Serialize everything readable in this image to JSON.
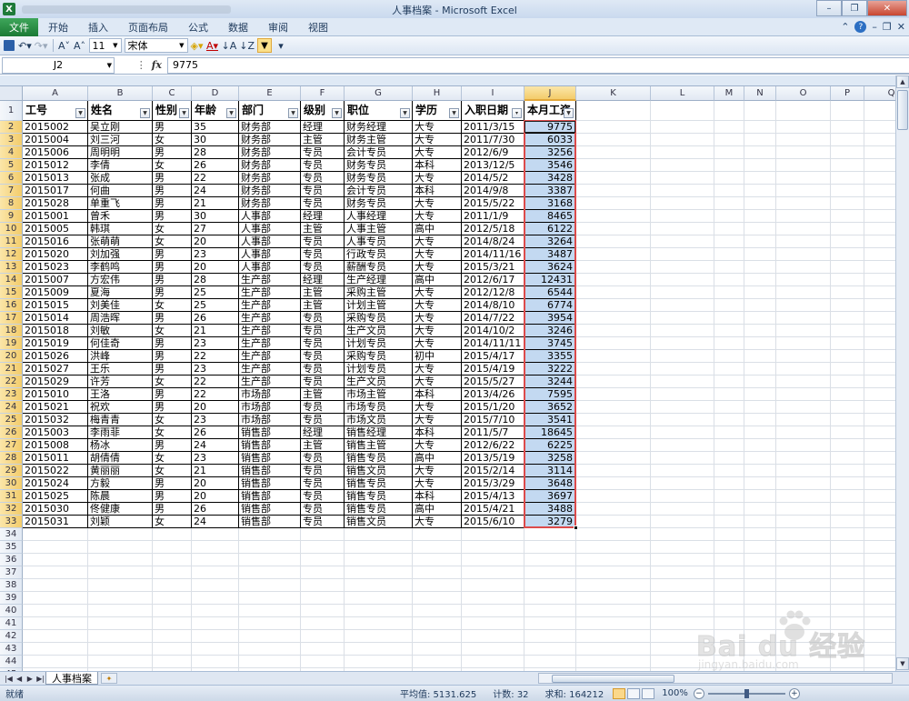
{
  "window": {
    "title": "人事档案  -  Microsoft Excel",
    "min": "–",
    "restore": "❐",
    "close": "✕"
  },
  "ribbon": {
    "tabs": [
      "文件",
      "开始",
      "插入",
      "页面布局",
      "公式",
      "数据",
      "审阅",
      "视图"
    ],
    "font_size": "11",
    "font_name": "宋体"
  },
  "formula_bar": {
    "name_box": "J2",
    "fx": "fx",
    "content": "9775"
  },
  "columns": [
    {
      "letter": "A",
      "w": 72
    },
    {
      "letter": "B",
      "w": 71
    },
    {
      "letter": "C",
      "w": 43
    },
    {
      "letter": "D",
      "w": 52
    },
    {
      "letter": "E",
      "w": 68
    },
    {
      "letter": "F",
      "w": 48
    },
    {
      "letter": "G",
      "w": 75
    },
    {
      "letter": "H",
      "w": 54
    },
    {
      "letter": "I",
      "w": 69
    },
    {
      "letter": "J",
      "w": 57
    },
    {
      "letter": "K",
      "w": 82
    },
    {
      "letter": "L",
      "w": 70
    },
    {
      "letter": "M",
      "w": 33
    },
    {
      "letter": "N",
      "w": 35
    },
    {
      "letter": "O",
      "w": 60
    },
    {
      "letter": "P",
      "w": 37
    },
    {
      "letter": "Q",
      "w": 60
    }
  ],
  "headers": [
    "工号",
    "姓名",
    "性别",
    "年龄",
    "部门",
    "级别",
    "职位",
    "学历",
    "入职日期",
    "本月工资"
  ],
  "rows": [
    [
      "2015002",
      "吴立刚",
      "男",
      "35",
      "财务部",
      "经理",
      "财务经理",
      "大专",
      "2011/3/15",
      "9775"
    ],
    [
      "2015004",
      "刘三河",
      "女",
      "30",
      "财务部",
      "主管",
      "财务主管",
      "大专",
      "2011/7/30",
      "6033"
    ],
    [
      "2015006",
      "周明明",
      "男",
      "28",
      "财务部",
      "专员",
      "会计专员",
      "大专",
      "2012/6/9",
      "3256"
    ],
    [
      "2015012",
      "李倩",
      "女",
      "26",
      "财务部",
      "专员",
      "财务专员",
      "本科",
      "2013/12/5",
      "3546"
    ],
    [
      "2015013",
      "张成",
      "男",
      "22",
      "财务部",
      "专员",
      "财务专员",
      "大专",
      "2014/5/2",
      "3428"
    ],
    [
      "2015017",
      "何曲",
      "男",
      "24",
      "财务部",
      "专员",
      "会计专员",
      "本科",
      "2014/9/8",
      "3387"
    ],
    [
      "2015028",
      "单重飞",
      "男",
      "21",
      "财务部",
      "专员",
      "财务专员",
      "大专",
      "2015/5/22",
      "3168"
    ],
    [
      "2015001",
      "曾禾",
      "男",
      "30",
      "人事部",
      "经理",
      "人事经理",
      "大专",
      "2011/1/9",
      "8465"
    ],
    [
      "2015005",
      "韩琪",
      "女",
      "27",
      "人事部",
      "主管",
      "人事主管",
      "高中",
      "2012/5/18",
      "6122"
    ],
    [
      "2015016",
      "张萌萌",
      "女",
      "20",
      "人事部",
      "专员",
      "人事专员",
      "大专",
      "2014/8/24",
      "3264"
    ],
    [
      "2015020",
      "刘加强",
      "男",
      "23",
      "人事部",
      "专员",
      "行政专员",
      "大专",
      "2014/11/16",
      "3487"
    ],
    [
      "2015023",
      "李鹤鸣",
      "男",
      "20",
      "人事部",
      "专员",
      "薪酬专员",
      "大专",
      "2015/3/21",
      "3624"
    ],
    [
      "2015007",
      "方宏伟",
      "男",
      "28",
      "生产部",
      "经理",
      "生产经理",
      "高中",
      "2012/6/17",
      "12431"
    ],
    [
      "2015009",
      "夏海",
      "男",
      "25",
      "生产部",
      "主管",
      "采购主管",
      "大专",
      "2012/12/8",
      "6544"
    ],
    [
      "2015015",
      "刘美佳",
      "女",
      "25",
      "生产部",
      "主管",
      "计划主管",
      "大专",
      "2014/8/10",
      "6774"
    ],
    [
      "2015014",
      "周浩晖",
      "男",
      "26",
      "生产部",
      "专员",
      "采购专员",
      "大专",
      "2014/7/22",
      "3954"
    ],
    [
      "2015018",
      "刘敏",
      "女",
      "21",
      "生产部",
      "专员",
      "生产文员",
      "大专",
      "2014/10/2",
      "3246"
    ],
    [
      "2015019",
      "何佳奇",
      "男",
      "23",
      "生产部",
      "专员",
      "计划专员",
      "大专",
      "2014/11/11",
      "3745"
    ],
    [
      "2015026",
      "洪峰",
      "男",
      "22",
      "生产部",
      "专员",
      "采购专员",
      "初中",
      "2015/4/17",
      "3355"
    ],
    [
      "2015027",
      "王乐",
      "男",
      "23",
      "生产部",
      "专员",
      "计划专员",
      "大专",
      "2015/4/19",
      "3222"
    ],
    [
      "2015029",
      "许芳",
      "女",
      "22",
      "生产部",
      "专员",
      "生产文员",
      "大专",
      "2015/5/27",
      "3244"
    ],
    [
      "2015010",
      "王洛",
      "男",
      "22",
      "市场部",
      "主管",
      "市场主管",
      "本科",
      "2013/4/26",
      "7595"
    ],
    [
      "2015021",
      "祝欢",
      "男",
      "20",
      "市场部",
      "专员",
      "市场专员",
      "大专",
      "2015/1/20",
      "3652"
    ],
    [
      "2015032",
      "梅青青",
      "女",
      "23",
      "市场部",
      "专员",
      "市场文员",
      "大专",
      "2015/7/10",
      "3541"
    ],
    [
      "2015003",
      "李雨菲",
      "女",
      "26",
      "销售部",
      "经理",
      "销售经理",
      "本科",
      "2011/5/7",
      "18645"
    ],
    [
      "2015008",
      "杨冰",
      "男",
      "24",
      "销售部",
      "主管",
      "销售主管",
      "大专",
      "2012/6/22",
      "6225"
    ],
    [
      "2015011",
      "胡倩倩",
      "女",
      "23",
      "销售部",
      "专员",
      "销售专员",
      "高中",
      "2013/5/19",
      "3258"
    ],
    [
      "2015022",
      "黄丽丽",
      "女",
      "21",
      "销售部",
      "专员",
      "销售文员",
      "大专",
      "2015/2/14",
      "3114"
    ],
    [
      "2015024",
      "方毅",
      "男",
      "20",
      "销售部",
      "专员",
      "销售专员",
      "大专",
      "2015/3/29",
      "3648"
    ],
    [
      "2015025",
      "陈晨",
      "男",
      "20",
      "销售部",
      "专员",
      "销售专员",
      "本科",
      "2015/4/13",
      "3697"
    ],
    [
      "2015030",
      "佟健康",
      "男",
      "26",
      "销售部",
      "专员",
      "销售专员",
      "高中",
      "2015/4/21",
      "3488"
    ],
    [
      "2015031",
      "刘颖",
      "女",
      "24",
      "销售部",
      "专员",
      "销售文员",
      "大专",
      "2015/6/10",
      "3279"
    ]
  ],
  "row_numbers": [
    "1",
    "2",
    "3",
    "4",
    "5",
    "6",
    "7",
    "8",
    "9",
    "10",
    "11",
    "12",
    "13",
    "14",
    "15",
    "16",
    "17",
    "18",
    "19",
    "20",
    "21",
    "22",
    "23",
    "24",
    "25",
    "26",
    "27",
    "28",
    "29",
    "30",
    "31",
    "32",
    "33",
    "34",
    "35",
    "36",
    "37",
    "38",
    "39",
    "40",
    "41",
    "42",
    "43",
    "44",
    "45"
  ],
  "sheet": {
    "tab": "人事档案"
  },
  "status": {
    "ready": "就绪",
    "average": "平均值: 5131.625",
    "count": "计数: 32",
    "sum": "求和: 164212",
    "zoom": "100%"
  },
  "watermark": {
    "text": "Bai du 经验",
    "sub": "jingyan.baidu.com"
  }
}
